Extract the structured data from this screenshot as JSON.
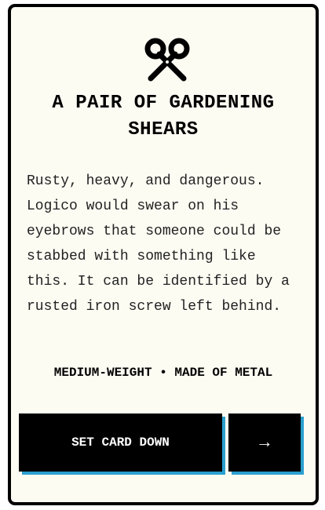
{
  "card": {
    "icon": "scissors-icon",
    "title": "A PAIR OF GARDENING SHEARS",
    "description": "Rusty, heavy, and dangerous. Logico would swear on his eyebrows that someone could be stabbed with something like this. It can be identified by a rusted iron screw left behind.",
    "meta": "MEDIUM-WEIGHT • MADE OF METAL"
  },
  "actions": {
    "set_down_label": "SET CARD DOWN",
    "next_label": "→"
  },
  "colors": {
    "card_background": "#fdfcf3",
    "button_background": "#000000",
    "button_shadow": "#2a9fcf"
  }
}
